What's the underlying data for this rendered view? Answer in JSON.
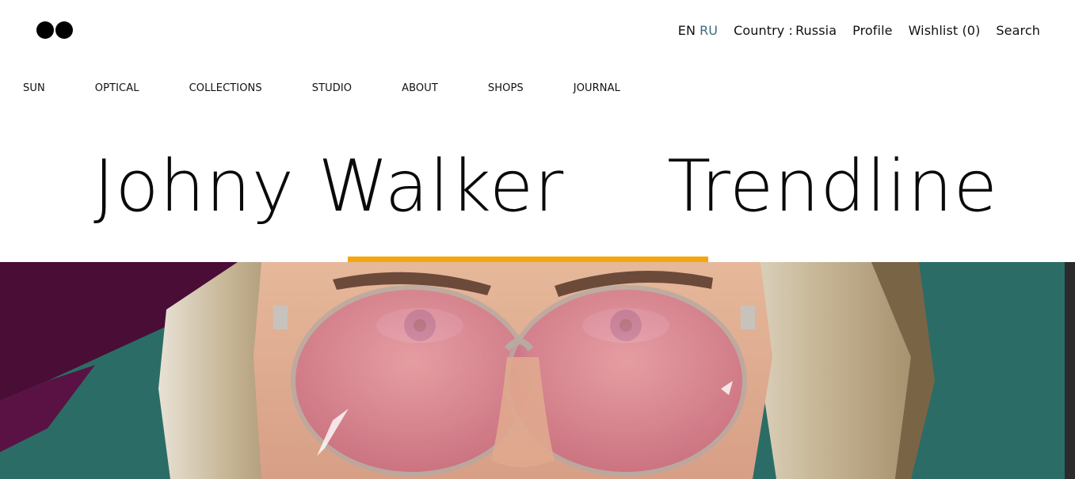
{
  "header": {
    "logo_icon": "two-dots-logo-icon",
    "languages": [
      {
        "code": "EN",
        "active": true
      },
      {
        "code": "RU",
        "active": false
      }
    ],
    "country_label": "Country :",
    "country_value": "Russia",
    "profile_label": "Profile",
    "wishlist_label": "Wishlist (0)",
    "search_label": "Search"
  },
  "nav": {
    "items": [
      {
        "label": "SUN"
      },
      {
        "label": "OPTICAL"
      },
      {
        "label": "COLLECTIONS"
      },
      {
        "label": "STUDIO"
      },
      {
        "label": "ABOUT"
      },
      {
        "label": "SHOPS"
      },
      {
        "label": "JOURNAL"
      }
    ]
  },
  "collections": {
    "titles": [
      {
        "label": "Johny Walker",
        "active": true
      },
      {
        "label": "Trendline",
        "active": false
      }
    ],
    "accent_color": "#f5a60a"
  },
  "hero": {
    "image": "woman-with-pink-tinted-round-sunglasses-illustration",
    "background_color": "#2a6b64"
  }
}
